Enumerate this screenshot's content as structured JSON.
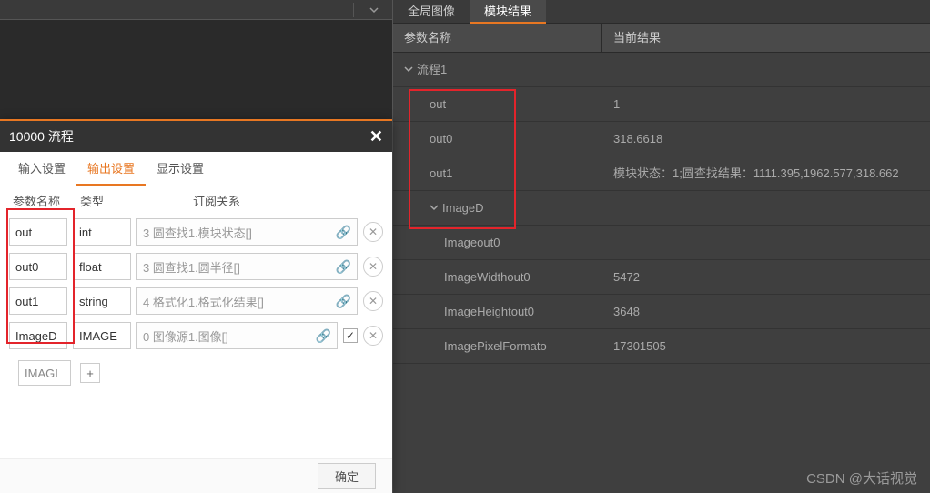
{
  "right": {
    "tabs": {
      "global": "全局图像",
      "module": "模块结果"
    },
    "header": {
      "param": "参数名称",
      "result": "当前结果"
    },
    "rows": {
      "flow": "流程1",
      "out": {
        "name": "out",
        "val": "1"
      },
      "out0": {
        "name": "out0",
        "val": "318.6618"
      },
      "out1": {
        "name": "out1",
        "val": "模块状态：1;圆查找结果：1111.395,1962.577,318.662"
      },
      "imaged": {
        "name": "ImageD",
        "val": ""
      },
      "imgout": {
        "name": "Imageout0",
        "val": ""
      },
      "imgw": {
        "name": "ImageWidthout0",
        "val": "5472"
      },
      "imgh": {
        "name": "ImageHeightout0",
        "val": "3648"
      },
      "imgp": {
        "name": "ImagePixelFormato",
        "val": "17301505"
      }
    }
  },
  "dialog": {
    "title": "10000 流程",
    "tabs": {
      "input": "输入设置",
      "output": "输出设置",
      "display": "显示设置"
    },
    "headers": {
      "name": "参数名称",
      "type": "类型",
      "sub": "订阅关系"
    },
    "rows": [
      {
        "name": "out",
        "type": "int",
        "sub": "3 圆查找1.模块状态[]"
      },
      {
        "name": "out0",
        "type": "float",
        "sub": "3 圆查找1.圆半径[]"
      },
      {
        "name": "out1",
        "type": "string",
        "sub": "4 格式化1.格式化结果[]"
      },
      {
        "name": "ImageD",
        "type": "IMAGE",
        "sub": "0 图像源1.图像[]"
      }
    ],
    "newInput": "IMAGI",
    "confirm": "确定"
  },
  "watermark": "CSDN @大话视觉"
}
